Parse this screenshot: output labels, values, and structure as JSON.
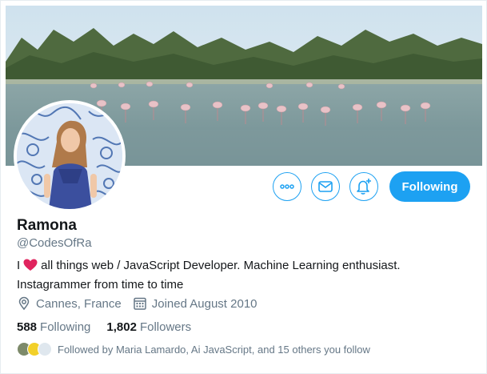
{
  "profile": {
    "name": "Ramona",
    "handle": "@CodesOfRa",
    "bio_prefix": "I",
    "bio_text": "all things web / JavaScript Developer. Machine Learning enthusiast. Instagrammer from time to time",
    "location": "Cannes, France",
    "joined": "Joined August 2010"
  },
  "stats": {
    "following_count": "588",
    "following_label": "Following",
    "followers_count": "1,802",
    "followers_label": "Followers"
  },
  "followed_by": "Followed by Maria Lamardo, Ai JavaScript, and 15 others you follow",
  "actions": {
    "more_icon": "more-icon",
    "message_icon": "envelope-icon",
    "notify_icon": "bell-plus-icon",
    "follow_label": "Following"
  },
  "colors": {
    "accent": "#1da1f2",
    "heart": "#e0245e",
    "secondary_text": "#657786"
  }
}
